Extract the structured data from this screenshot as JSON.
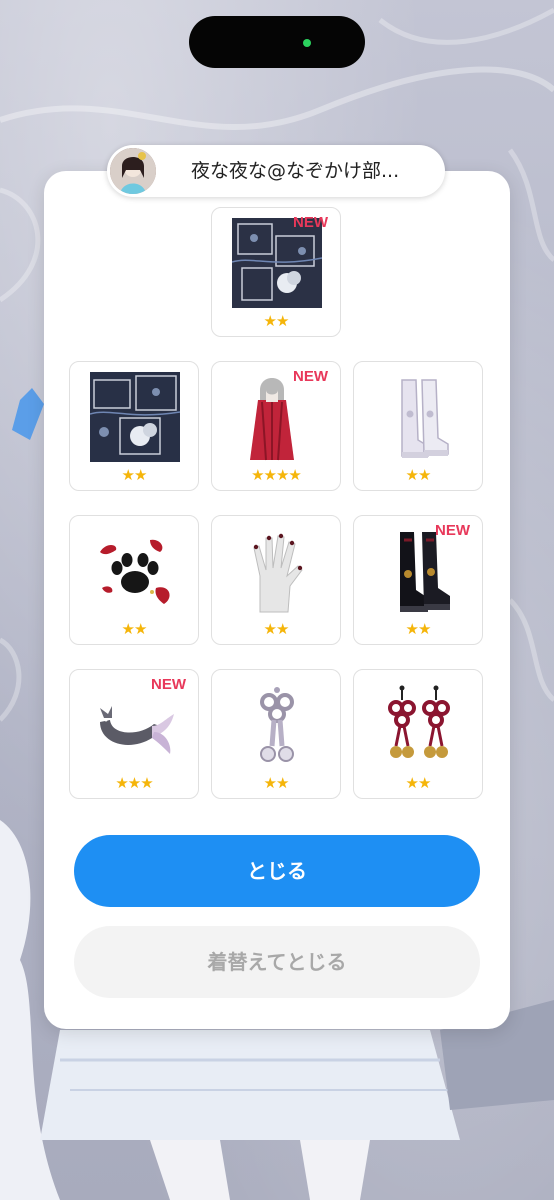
{
  "user": {
    "name": "夜な夜な@なぞかけ部...",
    "avatar_icon": "user-avatar"
  },
  "items": [
    {
      "name": "fabric-pattern-item",
      "stars": "★★",
      "new_badge": "NEW"
    },
    {
      "name": "fabric-pattern-item",
      "stars": "★★",
      "new_badge": ""
    },
    {
      "name": "long-red-hair-item",
      "stars": "★★★★",
      "new_badge": "NEW"
    },
    {
      "name": "white-boots-item",
      "stars": "★★",
      "new_badge": ""
    },
    {
      "name": "paw-print-item",
      "stars": "★★",
      "new_badge": ""
    },
    {
      "name": "glove-hand-item",
      "stars": "★★",
      "new_badge": ""
    },
    {
      "name": "black-boots-item",
      "stars": "★★",
      "new_badge": "NEW"
    },
    {
      "name": "fish-tail-item",
      "stars": "★★★",
      "new_badge": "NEW"
    },
    {
      "name": "knot-earring-item",
      "stars": "★★",
      "new_badge": ""
    },
    {
      "name": "red-knot-earrings-item",
      "stars": "★★",
      "new_badge": ""
    }
  ],
  "buttons": {
    "close_label": "とじる",
    "change_close_label": "着替えてとじる"
  },
  "colors": {
    "primary": "#1e8ff3",
    "new_badge": "#e8385a",
    "stars": "#f5b50a"
  }
}
